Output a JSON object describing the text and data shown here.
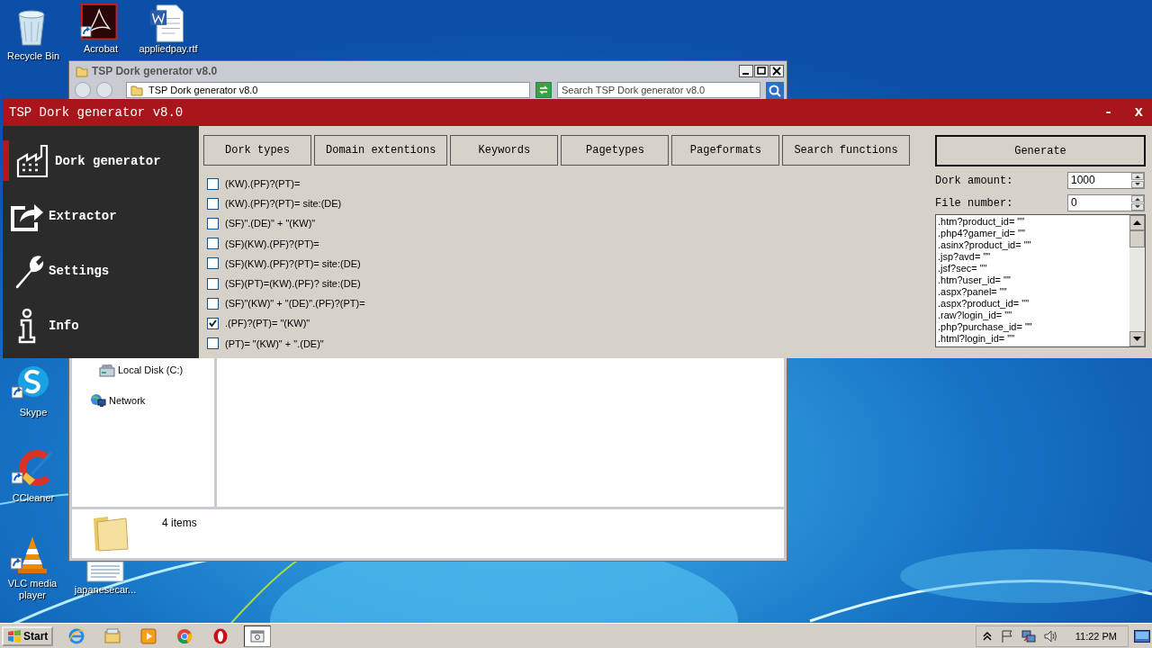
{
  "desktop_icons": [
    {
      "label": "Recycle Bin",
      "kind": "recycle"
    },
    {
      "label": "Acrobat",
      "kind": "acrobat"
    },
    {
      "label": "appliedpay.rtf",
      "kind": "word"
    },
    {
      "label": "Skype",
      "kind": "skype"
    },
    {
      "label": "CCleaner",
      "kind": "ccleaner"
    },
    {
      "label": "VLC media player",
      "kind": "vlc"
    },
    {
      "label": "japanesecar...",
      "kind": "textdoc"
    }
  ],
  "explorer": {
    "title": "TSP Dork generator v8.0",
    "address": "TSP Dork generator v8.0",
    "search_placeholder": "Search TSP Dork generator v8.0",
    "nav_items": [
      {
        "label": "Local Disk (C:)",
        "kind": "disk"
      },
      {
        "label": "Network",
        "kind": "network"
      }
    ],
    "details": "4 items"
  },
  "app": {
    "title": "TSP Dork generator v8.0",
    "minimize": "-",
    "close": "x",
    "sidebar": [
      {
        "label": "Dork generator",
        "kind": "factory",
        "selected": true
      },
      {
        "label": "Extractor",
        "kind": "share",
        "selected": false
      },
      {
        "label": "Settings",
        "kind": "wrench",
        "selected": false
      },
      {
        "label": "Info",
        "kind": "info",
        "selected": false
      }
    ],
    "tabs": [
      "Dork types",
      "Domain extentions",
      "Keywords",
      "Pagetypes",
      "Pageformats",
      "Search functions"
    ],
    "dork_types": [
      {
        "label": "(KW).(PF)?(PT)=",
        "checked": false
      },
      {
        "label": "(KW).(PF)?(PT)= site:(DE)",
        "checked": false
      },
      {
        "label": "(SF)\".(DE)\" + \"(KW)\"",
        "checked": false
      },
      {
        "label": "(SF)(KW).(PF)?(PT)=",
        "checked": false
      },
      {
        "label": "(SF)(KW).(PF)?(PT)= site:(DE)",
        "checked": false
      },
      {
        "label": "(SF)(PT)=(KW).(PF)? site:(DE)",
        "checked": false
      },
      {
        "label": "(SF)\"(KW)\" + \"(DE)\".(PF)?(PT)=",
        "checked": false
      },
      {
        "label": ".(PF)?(PT)= \"(KW)\"",
        "checked": true
      },
      {
        "label": "(PT)= \"(KW)\" + \".(DE)\"",
        "checked": false
      }
    ],
    "generate": "Generate",
    "dork_amount": {
      "label": "Dork amount:",
      "value": "1000"
    },
    "file_number": {
      "label": "File number:",
      "value": "0"
    },
    "pattern_list": [
      ".htm?product_id= \"\"",
      ".php4?gamer_id= \"\"",
      ".asinx?product_id= \"\"",
      ".jsp?avd= \"\"",
      ".jsf?sec= \"\"",
      ".htm?user_id= \"\"",
      ".aspx?panel= \"\"",
      ".aspx?product_id= \"\"",
      ".raw?login_id= \"\"",
      ".php?purchase_id= \"\"",
      ".html?login_id= \"\""
    ]
  },
  "taskbar": {
    "start": "Start",
    "apps": [
      {
        "kind": "ie",
        "selected": false
      },
      {
        "kind": "folder",
        "selected": false
      },
      {
        "kind": "media",
        "selected": false
      },
      {
        "kind": "chrome",
        "selected": false
      },
      {
        "kind": "opera",
        "selected": false
      },
      {
        "kind": "app",
        "selected": true
      }
    ],
    "clock": "11:22 PM"
  }
}
